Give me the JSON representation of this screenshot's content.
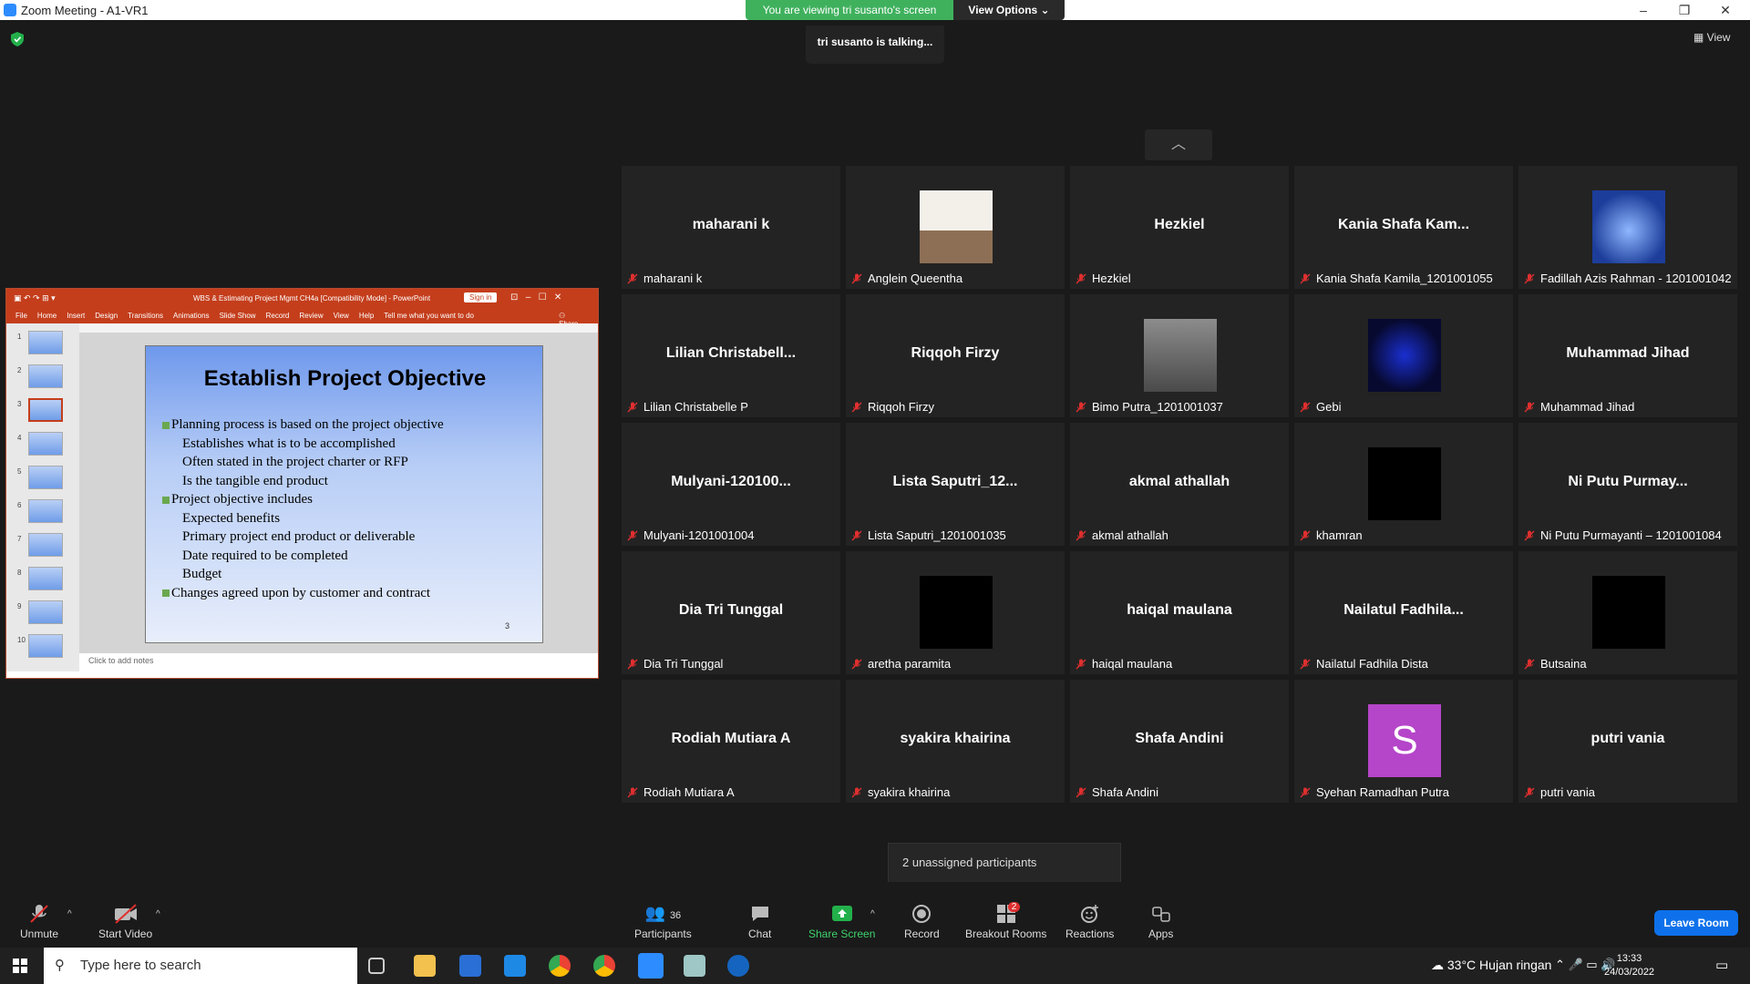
{
  "window": {
    "title": "Zoom Meeting - A1-VR1",
    "minimize": "–",
    "restore": "❐",
    "close": "✕"
  },
  "banner": {
    "viewing": "You are viewing tri susanto's screen",
    "view_options": "View Options ⌄"
  },
  "talking": "tri susanto is talking...",
  "view_button": "View",
  "tiles": [
    {
      "name": "maharani k",
      "label": "maharani k",
      "pic": null
    },
    {
      "name": "",
      "label": "Anglein Queentha",
      "pic": "laptop"
    },
    {
      "name": "Hezkiel",
      "label": "Hezkiel",
      "pic": null
    },
    {
      "name": "Kania  Shafa  Kam...",
      "label": "Kania Shafa Kamila_1201001055",
      "pic": null
    },
    {
      "name": "",
      "label": "Fadillah Azis Rahman - 1201001042",
      "pic": "blue"
    },
    {
      "name": "Lilian  Christabell...",
      "label": "Lilian Christabelle P",
      "pic": null
    },
    {
      "name": "Riqqoh Firzy",
      "label": "Riqqoh Firzy",
      "pic": null
    },
    {
      "name": "",
      "label": "Bimo Putra_1201001037",
      "pic": "person"
    },
    {
      "name": "",
      "label": "Gebi",
      "pic": "dark-blue"
    },
    {
      "name": "Muhammad Jihad",
      "label": "Muhammad Jihad",
      "pic": null
    },
    {
      "name": "Mulyani-120100...",
      "label": "Mulyani-1201001004",
      "pic": null
    },
    {
      "name": "Lista  Saputri_12...",
      "label": "Lista Saputri_1201001035",
      "pic": null
    },
    {
      "name": "akmal athallah",
      "label": "akmal athallah",
      "pic": null
    },
    {
      "name": "",
      "label": "khamran",
      "pic": "black"
    },
    {
      "name": "Ni  Putu  Purmay...",
      "label": "Ni Putu Purmayanti – 1201001084",
      "pic": null
    },
    {
      "name": "Dia Tri Tunggal",
      "label": "Dia Tri Tunggal",
      "pic": null
    },
    {
      "name": "",
      "label": "aretha paramita",
      "pic": "black"
    },
    {
      "name": "haiqal maulana",
      "label": "haiqal maulana",
      "pic": null
    },
    {
      "name": "Nailatul  Fadhila...",
      "label": "Nailatul Fadhila Dista",
      "pic": null
    },
    {
      "name": "",
      "label": "Butsaina",
      "pic": "black"
    },
    {
      "name": "Rodiah Mutiara A",
      "label": "Rodiah Mutiara A",
      "pic": null
    },
    {
      "name": "syakira khairina",
      "label": "syakira khairina",
      "pic": null
    },
    {
      "name": "Shafa Andini",
      "label": "Shafa Andini",
      "pic": null
    },
    {
      "name": "",
      "label": "Syehan Ramadhan Putra",
      "pic": "letter-S"
    },
    {
      "name": "putri vania",
      "label": "putri vania",
      "pic": null
    }
  ],
  "avatar_letter": "S",
  "unassigned": "2 unassigned participants",
  "ppt": {
    "title": "WBS & Estimating Project Mgmt CH4a [Compatibility Mode] - PowerPoint",
    "sign_in": "Sign in",
    "tabs": [
      "File",
      "Home",
      "Insert",
      "Design",
      "Transitions",
      "Animations",
      "Slide Show",
      "Record",
      "Review",
      "View",
      "Help",
      "Tell me what you want to do"
    ],
    "share": "Share",
    "thumb_numbers": [
      "1",
      "2",
      "3",
      "4",
      "5",
      "6",
      "7",
      "8",
      "9",
      "10"
    ],
    "slide_title": "Establish Project Objective",
    "slide_lines": [
      {
        "level": 1,
        "text": "Planning process is based on the project objective"
      },
      {
        "level": 2,
        "text": "Establishes what is to be accomplished"
      },
      {
        "level": 2,
        "text": "Often stated in the project charter or RFP"
      },
      {
        "level": 2,
        "text": "Is the tangible end product"
      },
      {
        "level": 1,
        "text": "Project objective includes"
      },
      {
        "level": 2,
        "text": "Expected benefits"
      },
      {
        "level": 2,
        "text": "Primary project end product or deliverable"
      },
      {
        "level": 2,
        "text": "Date required to be completed"
      },
      {
        "level": 2,
        "text": "Budget"
      },
      {
        "level": 1,
        "text": "Changes agreed upon by customer and contract"
      }
    ],
    "slide_number": "3",
    "notes": "Click to add notes"
  },
  "toolbar": {
    "unmute": "Unmute",
    "start_video": "Start Video",
    "participants": "Participants",
    "participants_count": "36",
    "chat": "Chat",
    "share_screen": "Share Screen",
    "record": "Record",
    "breakout_rooms": "Breakout Rooms",
    "breakout_badge": "2",
    "reactions": "Reactions",
    "apps": "Apps",
    "leave": "Leave Room"
  },
  "taskbar": {
    "search_placeholder": "Type here to search",
    "weather": "33°C  Hujan ringan",
    "time": "13:33",
    "date": "24/03/2022"
  },
  "colors": {
    "accent": "#0e71eb",
    "banner_green": "#3fb15d",
    "ppt_red": "#c43e1c",
    "mic_muted": "#e02f2f"
  }
}
